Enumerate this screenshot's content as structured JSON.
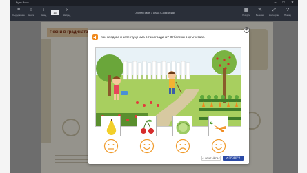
{
  "window": {
    "app_title": "Буки Book",
    "doc_title": "Околен свят 1 клас (Софийска)",
    "min": "–",
    "max": "□",
    "close": "✕"
  },
  "toolbar": {
    "left_tools": [
      {
        "icon": "menu-icon",
        "glyph": "≡",
        "label": "Съдържание"
      },
      {
        "icon": "home-icon",
        "glyph": "⌂",
        "label": "Начало"
      },
      {
        "icon": "prev-page-icon",
        "glyph": "‹",
        "label": "Назад"
      }
    ],
    "page_number": "16",
    "next_glyph": "›",
    "next_label": "Напред",
    "right_tools": [
      {
        "icon": "resources-icon",
        "glyph": "▦",
        "label": "Ресурси"
      },
      {
        "icon": "notes-icon",
        "glyph": "✎",
        "label": "Бележки"
      },
      {
        "icon": "fullscreen-icon",
        "glyph": "⤢",
        "label": "Цял екран"
      },
      {
        "icon": "help-icon",
        "glyph": "?",
        "label": "Помощ"
      }
    ]
  },
  "page": {
    "banner": "Песни в градината"
  },
  "modal": {
    "question": "Кои плодове и зеленчуци има в тази градина? Отбележи в кръгчетата.",
    "close_glyph": "⊗",
    "cards": [
      {
        "name": "pear",
        "label": "круша"
      },
      {
        "name": "cherries",
        "label": "череши"
      },
      {
        "name": "cabbage",
        "label": "зеле"
      },
      {
        "name": "carrots",
        "label": "моркови"
      }
    ],
    "faces": [
      "neutral",
      "happy",
      "sad",
      "happy"
    ],
    "reset_label": "↺ ОПИТАЙ ПАК",
    "check_label": "✔ ПРОВЕРИ"
  },
  "colors": {
    "accent_blue": "#2b4aa6",
    "speaker_orange": "#f08a1f",
    "face_orange": "#f09a2a",
    "titlebar": "#1c1f26",
    "toolbar": "#2a2f39"
  }
}
